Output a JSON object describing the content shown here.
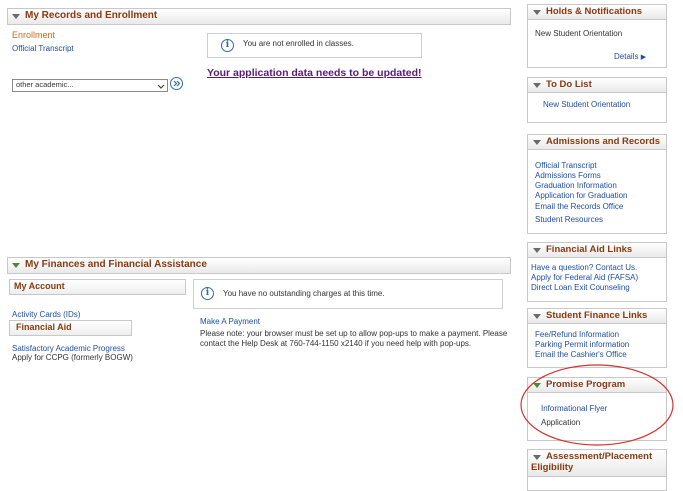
{
  "records": {
    "title": "My Records and Enrollment",
    "enrollment_label": "Enrollment",
    "official_transcript": "Official Transcript",
    "select_value": "other academic...",
    "go_icon": "double-chevron-right-icon",
    "not_enrolled": "You are not enrolled in classes.",
    "update_link": "Your application data needs to be updated!"
  },
  "finances": {
    "title": "My Finances and Financial Assistance",
    "my_account": "My Account",
    "activity_cards": "Activity Cards (IDs)",
    "financial_aid": "Financial Aid",
    "sap": "Satisfactory Academic Progress",
    "ccpg": "Apply for CCPG (formerly BOGW)",
    "no_charges": "You have no outstanding charges at this time.",
    "make_payment": "Make A Payment",
    "note_line1": "Please note: your browser must be set up to allow pop-ups to make a payment.  Please",
    "note_line2": "contact the Help Desk at 760-744-1150 x2140 if you need help with pop-ups."
  },
  "sidebar": {
    "holds": {
      "title": "Holds & Notifications",
      "item": "New Student Orientation",
      "details": "Details"
    },
    "todo": {
      "title": "To Do List",
      "item": "New Student Orientation"
    },
    "admissions": {
      "title": "Admissions and Records",
      "items": [
        "Official Transcript",
        "Admissions Forms",
        "Graduation Information",
        "Application for Graduation",
        "Email the Records Office",
        "Student Resources"
      ]
    },
    "finaid": {
      "title": "Financial Aid Links",
      "items": [
        "Have a question? Contact Us.",
        "Apply for Federal Aid (FAFSA)",
        "Direct Loan Exit Counseling"
      ]
    },
    "finance": {
      "title": "Student Finance Links",
      "items": [
        "Fee/Refund Information",
        "Parking Permit information",
        "Email the Cashier's Office"
      ]
    },
    "promise": {
      "title": "Promise Program",
      "flyer": "Informational Flyer",
      "application": "Application"
    },
    "assessment": {
      "title_line1": "Assessment/Placement",
      "title_line2": "Eligibility"
    }
  },
  "colors": {
    "header_text": "#8a3a10",
    "link": "#1f4fa3",
    "annotation_circle": "#d9302c",
    "update_link": "#5a1a7a"
  }
}
